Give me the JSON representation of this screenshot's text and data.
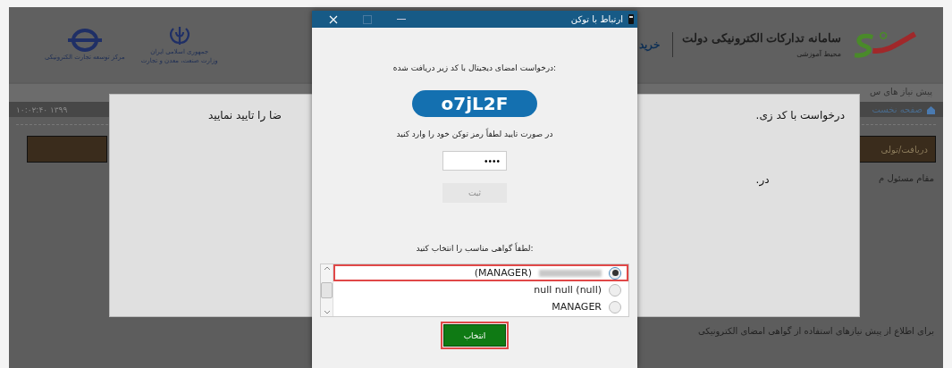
{
  "site": {
    "title": "سامانه تدارکات الکترونیکی دولت",
    "subtitle": "محیط آموزشی",
    "link": "خرید",
    "ministry_lines": [
      "جمهوری اسلامی ایران",
      "وزارت صنعت، معدن و تجارت"
    ],
    "center_name": "مرکز توسعه تجارت الکترونیکی"
  },
  "nav": {
    "items": [
      "پیش نیاز های س"
    ]
  },
  "breadcrumb": {
    "home": "صفحه نخست",
    "datetime": "۱۰:۰۲:۴۰  ۱۳۹۹"
  },
  "content": {
    "action_button": "دریافت/تولی",
    "line": "مقام مسئول م",
    "footer_line": "برای اطلاع از پیش نیازهای استفاده از گواهی امضای الکترونیکی"
  },
  "modal": {
    "right_lines": [
      ".درخواست با کد زی",
      ".در"
    ],
    "left_lines": [
      "ضا را تایید نمایید"
    ]
  },
  "dialog": {
    "title": "ارتباط با توکن",
    "request_text": "درخواست امضای دیجیتال با کد زیر دریافت شده:",
    "code": "o7jL2F",
    "pin_prompt": "در صورت تایید لطفاً رمز توکن خود را وارد کنید",
    "pin_value": "••••",
    "submit": {
      "label": "ثبت",
      "disabled": true
    },
    "cert_prompt": "لطفاً گواهی مناسب را انتخاب کنید:",
    "certificates": [
      {
        "label": "(MANAGER)",
        "blurred": true,
        "selected": true
      },
      {
        "label": "null null (null)",
        "blurred": false,
        "selected": false
      },
      {
        "label": "MANAGER",
        "blurred": false,
        "selected": false
      }
    ],
    "choose": "انتخاب"
  }
}
